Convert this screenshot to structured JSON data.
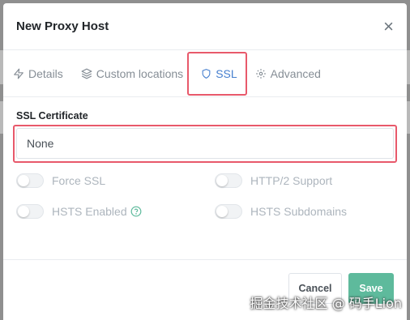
{
  "modal": {
    "title": "New Proxy Host",
    "close_symbol": "×"
  },
  "tabs": [
    {
      "label": "Details",
      "icon": "bolt-icon"
    },
    {
      "label": "Custom locations",
      "icon": "layers-icon"
    },
    {
      "label": "SSL",
      "icon": "shield-icon",
      "active": true
    },
    {
      "label": "Advanced",
      "icon": "gear-icon"
    }
  ],
  "ssl": {
    "certificate_label": "SSL Certificate",
    "certificate_value": "None"
  },
  "toggles": [
    {
      "label": "Force SSL",
      "enabled": false
    },
    {
      "label": "HTTP/2 Support",
      "enabled": false
    },
    {
      "label": "HSTS Enabled",
      "enabled": false,
      "help_icon": "question-circle-icon"
    },
    {
      "label": "HSTS Subdomains",
      "enabled": false
    }
  ],
  "footer": {
    "cancel_label": "Cancel",
    "save_label": "Save"
  },
  "watermark": "掘金技术社区 @ 码手Lion",
  "colors": {
    "accent": "#467fcf",
    "save": "#5eba9c",
    "highlight": "#e8596b"
  }
}
